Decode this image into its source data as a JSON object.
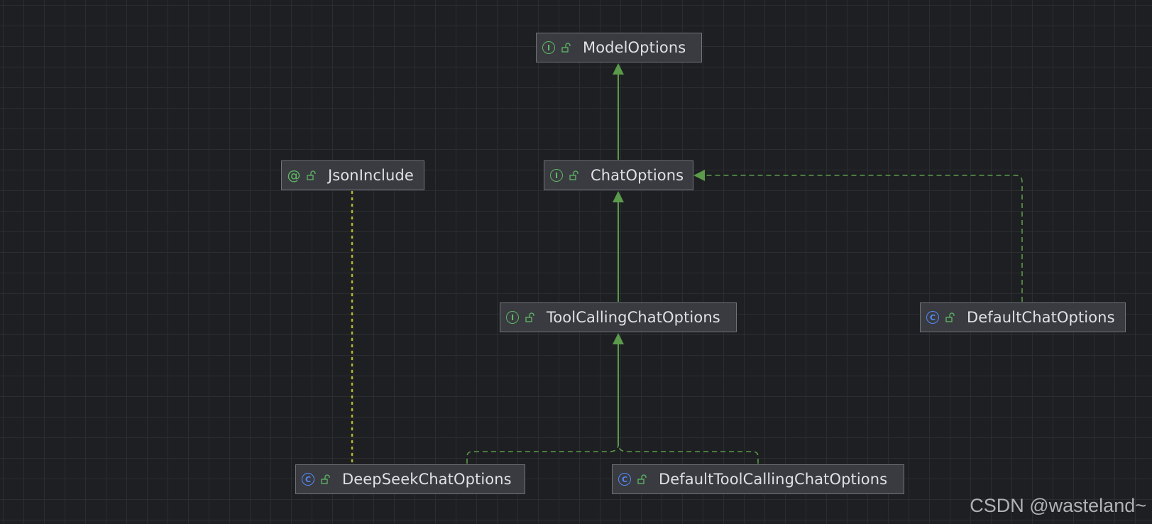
{
  "nodes": {
    "model_options": {
      "label": "ModelOptions",
      "kind": "interface",
      "kind_glyph": "I"
    },
    "chat_options": {
      "label": "ChatOptions",
      "kind": "interface",
      "kind_glyph": "I"
    },
    "json_include": {
      "label": "JsonInclude",
      "kind": "annotation",
      "kind_glyph": "@"
    },
    "tool_calling_chat_options": {
      "label": "ToolCallingChatOptions",
      "kind": "interface",
      "kind_glyph": "I"
    },
    "default_chat_options": {
      "label": "DefaultChatOptions",
      "kind": "class",
      "kind_glyph": "C"
    },
    "deepseek_chat_options": {
      "label": "DeepSeekChatOptions",
      "kind": "class",
      "kind_glyph": "C"
    },
    "default_tool_calling_chat_options": {
      "label": "DefaultToolCallingChatOptions",
      "kind": "class",
      "kind_glyph": "C"
    }
  },
  "edges": [
    {
      "from": "ChatOptions",
      "to": "ModelOptions",
      "type": "extends"
    },
    {
      "from": "ToolCallingChatOptions",
      "to": "ChatOptions",
      "type": "extends"
    },
    {
      "from": "DefaultChatOptions",
      "to": "ChatOptions",
      "type": "implements"
    },
    {
      "from": "DeepSeekChatOptions",
      "to": "ToolCallingChatOptions",
      "type": "implements"
    },
    {
      "from": "DefaultToolCallingChatOptions",
      "to": "ToolCallingChatOptions",
      "type": "implements"
    },
    {
      "from": "DeepSeekChatOptions",
      "to": "JsonInclude",
      "type": "annotated"
    }
  ],
  "colors": {
    "background": "#1e1f22",
    "node_fill": "#393b40",
    "node_border": "#6f737a",
    "edge": "#5a9a4a",
    "annotation_edge": "#b5b82a",
    "interface_icon": "#5fb865",
    "class_icon": "#548af7"
  },
  "watermark": "CSDN @wasteland~"
}
